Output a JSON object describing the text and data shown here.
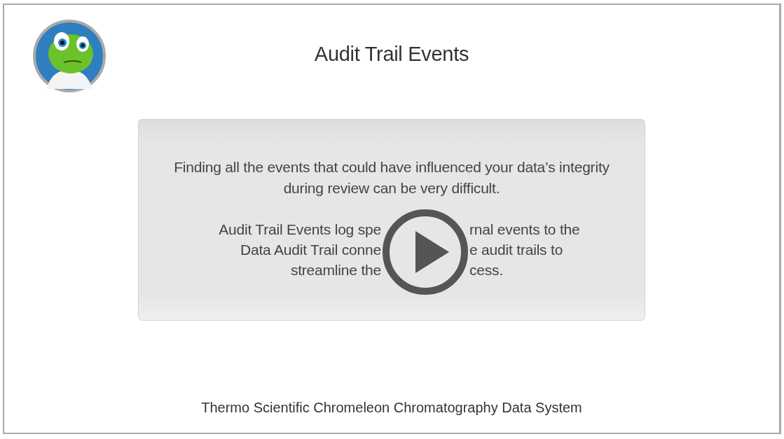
{
  "title": "Audit Trail Events",
  "paragraph": "Finding all the events that could have influenced your data’s integrity during review can be very difficult.",
  "covered_paragraph_lines": [
    [
      "Audit Trail Events log spe",
      "rnal events to the"
    ],
    [
      "Data Audit Trail conne",
      "e audit trails to"
    ],
    [
      "streamline the",
      "cess."
    ]
  ],
  "footer": "Thermo Scientific Chromeleon Chromatography Data System"
}
